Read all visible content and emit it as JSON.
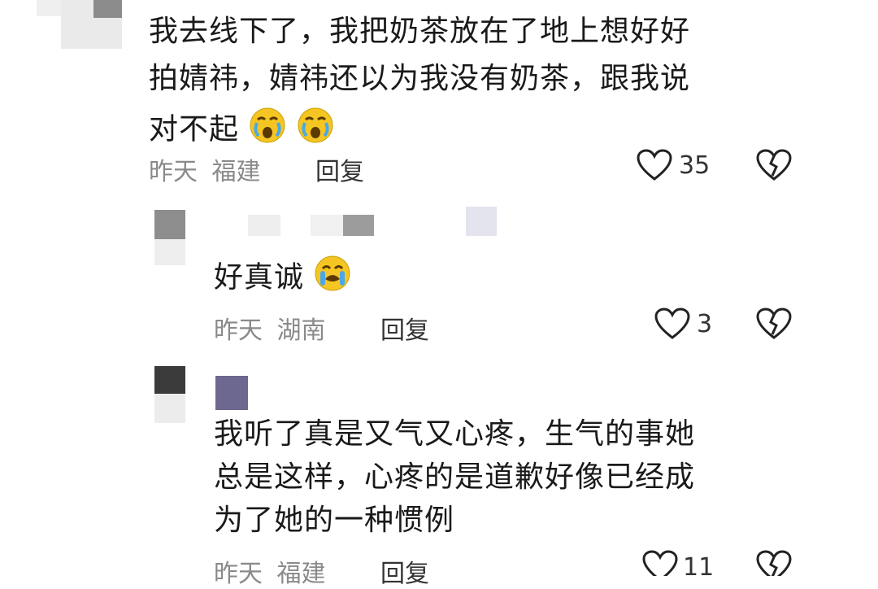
{
  "comments": [
    {
      "text_lines": [
        "我去线下了，我把奶茶放在了地上想好好",
        "拍婧祎，婧祎还以为我没有奶茶，跟我说",
        "对不起"
      ],
      "emoji": "crying-face-emoji",
      "date": "昨天",
      "location": "福建",
      "reply": "回复",
      "likes": "35"
    },
    {
      "text": "好真诚",
      "emoji": "crying-face-emoji",
      "date": "昨天",
      "location": "湖南",
      "reply": "回复",
      "likes": "3"
    },
    {
      "text_lines": [
        "我听了真是又气又心疼，生气的事她",
        "总是这样，心疼的是道歉好像已经成",
        "为了她的一种惯例"
      ],
      "date": "昨天",
      "location": "福建",
      "reply": "回复",
      "likes": "11"
    }
  ],
  "icons": {
    "like": "heart-icon",
    "dislike": "broken-heart-icon"
  },
  "colors": {
    "text": "#1a1a1a",
    "meta": "#8a8a8a",
    "emoji_yellow": "#f5c623",
    "emoji_tear": "#4aa8e8"
  }
}
